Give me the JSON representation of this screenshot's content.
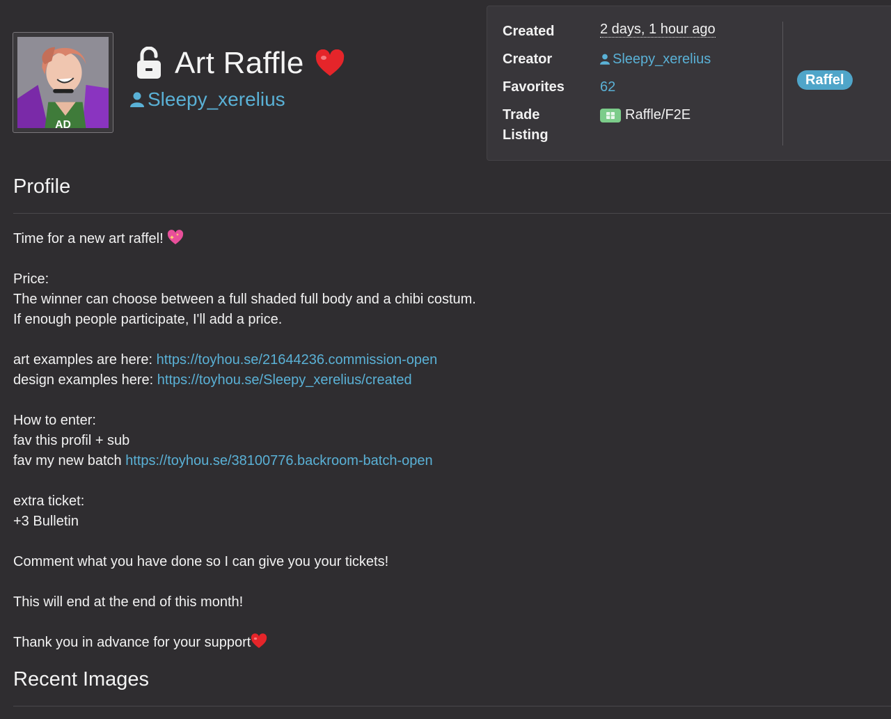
{
  "header": {
    "title": "Art Raffle",
    "owner_name": "Sleepy_xerelius"
  },
  "info": {
    "created_label": "Created",
    "created_value": "2 days, 1 hour ago",
    "creator_label": "Creator",
    "creator_value": "Sleepy_xerelius",
    "favorites_label": "Favorites",
    "favorites_value": "62",
    "trade_label_line1": "Trade",
    "trade_label_line2": "Listing",
    "trade_value": "Raffle/F2E",
    "tag": "Raffel"
  },
  "profile": {
    "heading": "Profile",
    "line_intro": "Time for a new art raffel!",
    "price_label": "Price:",
    "price_line1": "The winner can choose between a full shaded full body and a chibi costum.",
    "price_line2": "If enough people participate, I'll add a price.",
    "art_examples_label": "art examples are here: ",
    "art_examples_link": "https://toyhou.se/21644236.commission-open",
    "design_examples_label": "design examples here: ",
    "design_examples_link": "https://toyhou.se/Sleepy_xerelius/created",
    "how_to_enter": "How to enter:",
    "enter_line1": "fav this profil + sub",
    "enter_line2_label": "fav my new batch ",
    "enter_line2_link": "https://toyhou.se/38100776.backroom-batch-open",
    "extra_ticket": "extra ticket:",
    "extra_line": "+3 Bulletin",
    "comment_line": "Comment what you have done so I can give you your tickets!",
    "end_line": "This will end at the end of this month!",
    "thanks_line": "Thank you in advance for your support"
  },
  "recent": {
    "heading": "Recent Images"
  },
  "colors": {
    "background": "#2f2d30",
    "link": "#5ab1d6",
    "tag": "#4fa5c9",
    "heart": "#e5252a"
  }
}
